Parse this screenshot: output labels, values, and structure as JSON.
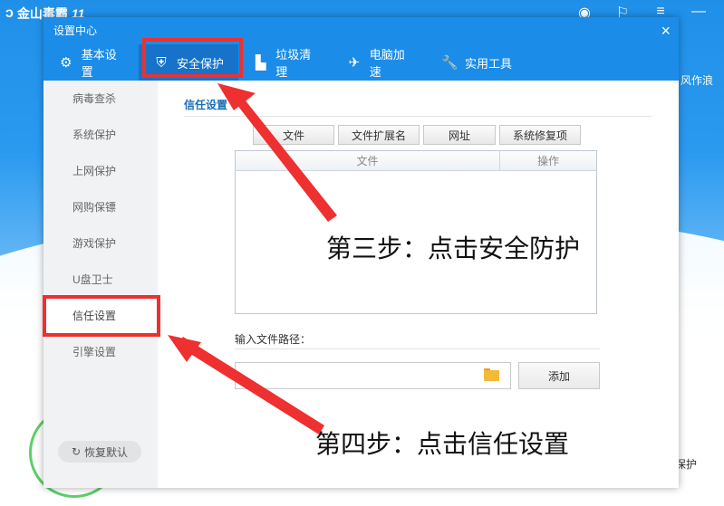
{
  "background_app": {
    "name": "金山毒霸",
    "version": "11",
    "side_text": "风作浪",
    "bottom_text": "保护"
  },
  "dialog": {
    "title": "设置中心",
    "close_glyph": "×",
    "tabs": [
      {
        "label": "基本设置",
        "icon": "gear-icon",
        "glyph": "⚙"
      },
      {
        "label": "安全保护",
        "icon": "shield-icon",
        "glyph": "⛨"
      },
      {
        "label": "垃圾清理",
        "icon": "broom-icon",
        "glyph": "▙"
      },
      {
        "label": "电脑加速",
        "icon": "rocket-icon",
        "glyph": "✈"
      },
      {
        "label": "实用工具",
        "icon": "wrench-icon",
        "glyph": "🔧"
      }
    ],
    "active_tab": "安全保护",
    "sidebar": {
      "items": [
        "病毒查杀",
        "系统保护",
        "上网保护",
        "网购保镖",
        "游戏保护",
        "U盘卫士",
        "信任设置",
        "引擎设置"
      ],
      "active_item": "信任设置",
      "restore_label": "恢复默认",
      "restore_glyph": "↻"
    },
    "content": {
      "section_title": "信任设置",
      "subtabs": [
        "文件",
        "文件扩展名",
        "网址",
        "系统修复项"
      ],
      "table_headers": [
        "文件",
        "操作"
      ],
      "path_label": "输入文件路径：",
      "path_value": "",
      "add_label": "添加"
    }
  },
  "annotations": {
    "step3": "第三步：点击安全防护",
    "step4": "第四步：点击信任设置",
    "color": "#ee3030"
  }
}
